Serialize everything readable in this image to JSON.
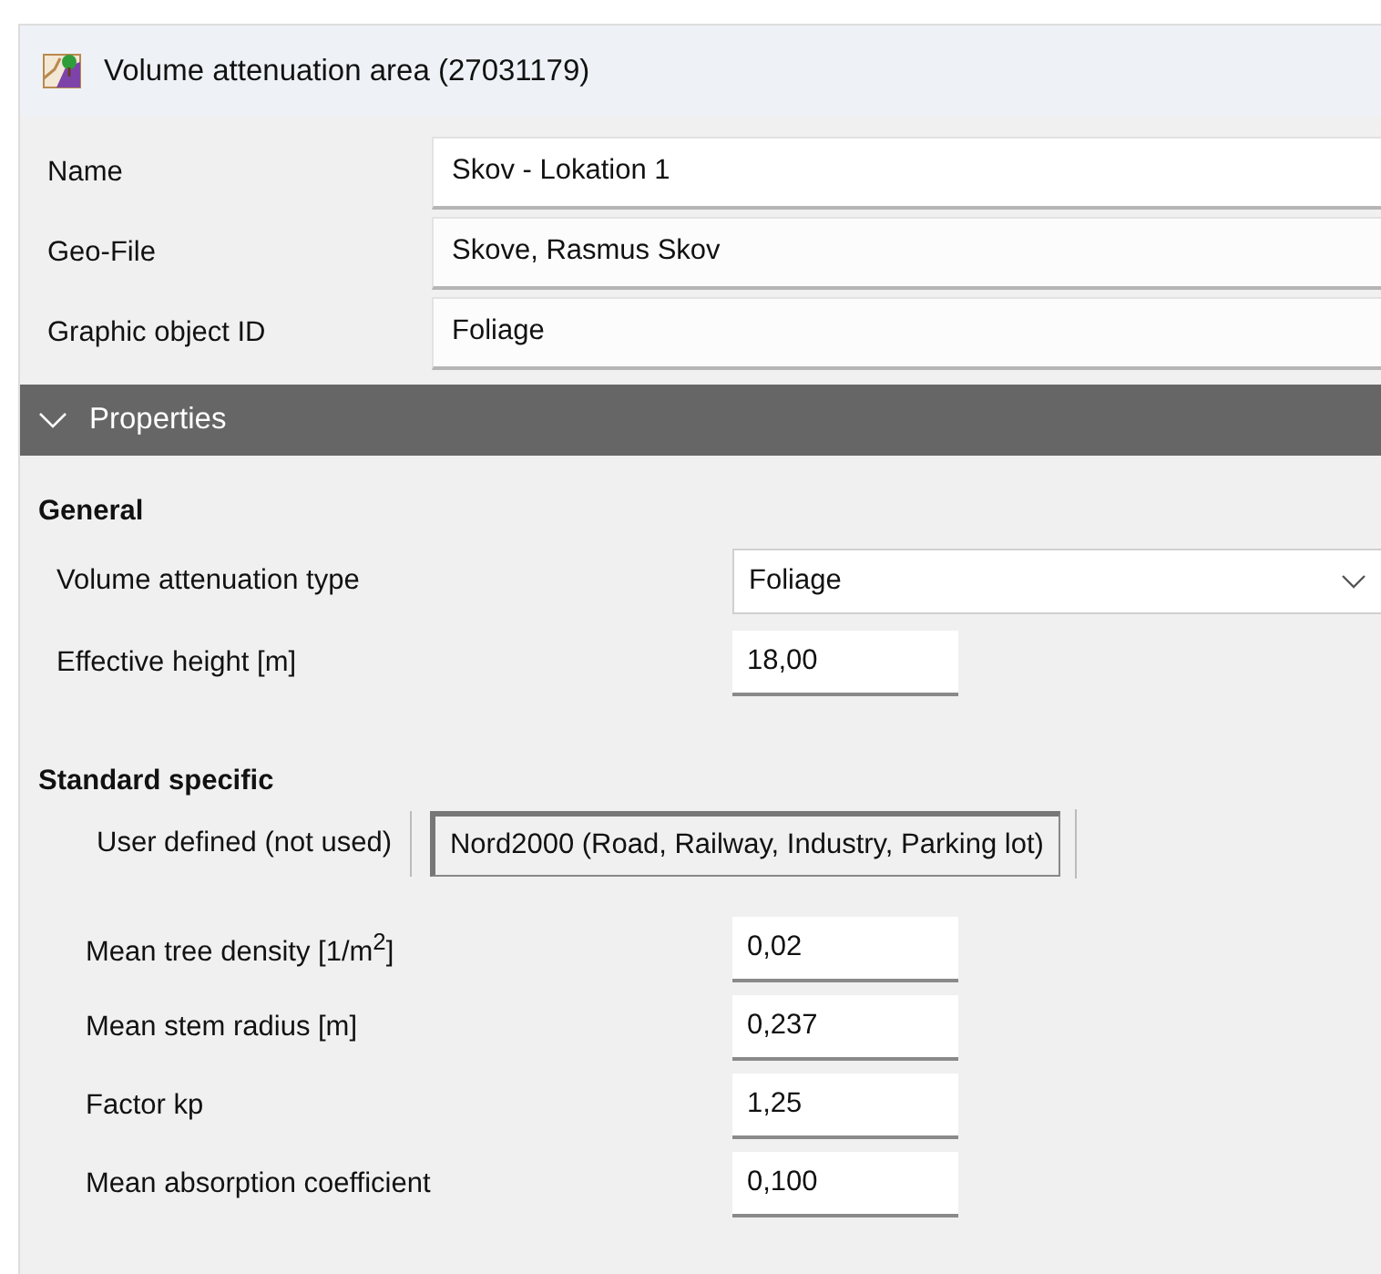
{
  "window": {
    "title": "Volume attenuation area (27031179)"
  },
  "header_fields": [
    {
      "label": "Name",
      "value": "Skov - Lokation 1"
    },
    {
      "label": "Geo-File",
      "value": "Skove, Rasmus Skov"
    },
    {
      "label": "Graphic object ID",
      "value": "Foliage"
    }
  ],
  "properties": {
    "title": "Properties",
    "expanded": true,
    "general": {
      "heading": "General",
      "rows": [
        {
          "kind": "dropdown",
          "label": "Volume attenuation type",
          "value": "Foliage"
        },
        {
          "kind": "input",
          "label": "Effective height [m]",
          "value": "18,00"
        }
      ]
    },
    "standard_specific": {
      "heading": "Standard specific",
      "tabs": [
        {
          "label": "User defined (not used)",
          "selected": false
        },
        {
          "label": "Nord2000 (Road, Railway, Industry, Parking lot)",
          "selected": true
        }
      ],
      "rows": [
        {
          "label": "Mean tree density [1/m$^{2}$]",
          "value": "0,02"
        },
        {
          "label": "Mean stem radius [m]",
          "value": "0,237"
        },
        {
          "label": "Factor kp",
          "value": "1,25"
        },
        {
          "label": "Mean absorption coefficient",
          "value": "0,100"
        }
      ]
    }
  }
}
